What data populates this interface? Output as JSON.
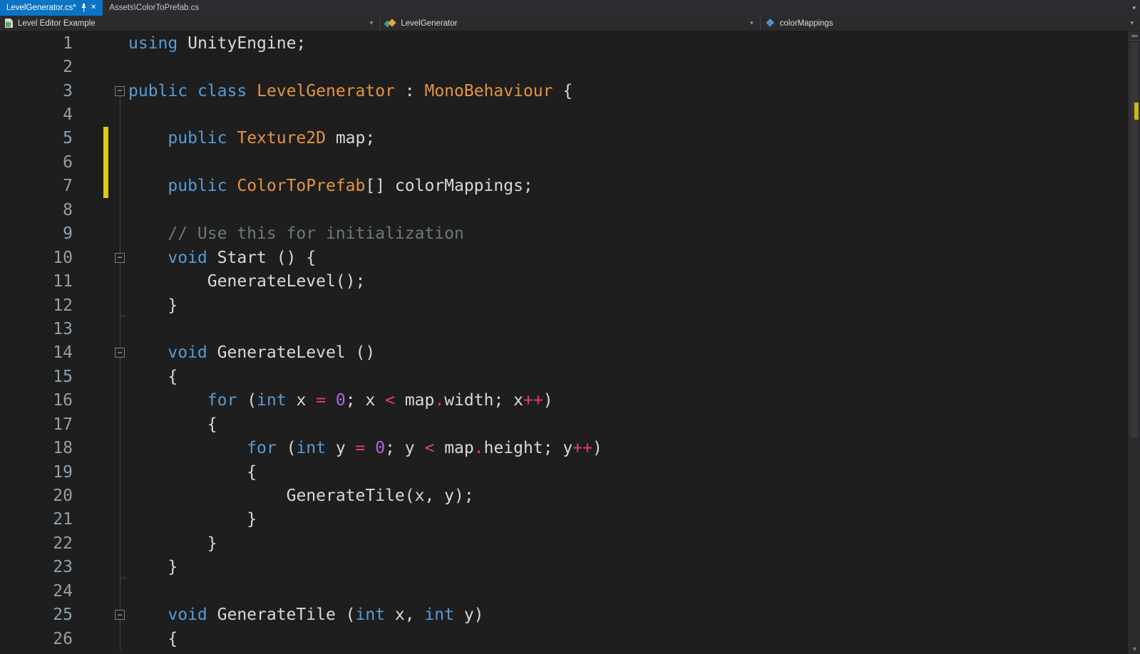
{
  "colors": {
    "accent_blue": "#0b74c4",
    "keyword": "#569cd6",
    "type": "#e39440",
    "operator": "#e23d7f",
    "number": "#a36ae0",
    "comment": "#6d787e",
    "plain": "#d8d8d8",
    "line_number": "#8fa0ac",
    "change_bar_yellow": "#ddc81c"
  },
  "icons": {
    "chevron_down": "▾",
    "close": "✕",
    "fold_collapse": "−"
  },
  "tabs": [
    {
      "label": "LevelGenerator.cs*",
      "active": true
    },
    {
      "label": "Assets\\ColorToPrefab.cs",
      "active": false
    }
  ],
  "nav": {
    "items": [
      {
        "label": "Level Editor Example"
      },
      {
        "label": "LevelGenerator"
      },
      {
        "label": "colorMappings"
      }
    ]
  },
  "editor": {
    "language": "csharp",
    "lines": [
      {
        "n": "1",
        "indent": 0,
        "tokens": [
          [
            "k",
            "using"
          ],
          [
            "p",
            " UnityEngine;"
          ]
        ]
      },
      {
        "n": "2",
        "indent": 0,
        "tokens": []
      },
      {
        "n": "3",
        "indent": 0,
        "fold": true,
        "tokens": [
          [
            "k",
            "public"
          ],
          [
            "p",
            " "
          ],
          [
            "k",
            "class"
          ],
          [
            "p",
            " "
          ],
          [
            "t",
            "LevelGenerator"
          ],
          [
            "p",
            " : "
          ],
          [
            "t",
            "MonoBehaviour"
          ],
          [
            "p",
            " {"
          ]
        ]
      },
      {
        "n": "4",
        "indent": 0,
        "guide": true,
        "tokens": []
      },
      {
        "n": "5",
        "indent": 1,
        "guide": true,
        "changed": true,
        "tokens": [
          [
            "k",
            "public"
          ],
          [
            "p",
            " "
          ],
          [
            "t",
            "Texture2D"
          ],
          [
            "p",
            " map;"
          ]
        ]
      },
      {
        "n": "6",
        "indent": 0,
        "guide": true,
        "changed": true,
        "tokens": []
      },
      {
        "n": "7",
        "indent": 1,
        "guide": true,
        "changed": true,
        "tokens": [
          [
            "k",
            "public"
          ],
          [
            "p",
            " "
          ],
          [
            "t",
            "ColorToPrefab"
          ],
          [
            "p",
            "[] colorMappings;"
          ]
        ]
      },
      {
        "n": "8",
        "indent": 0,
        "guide": true,
        "tokens": []
      },
      {
        "n": "9",
        "indent": 1,
        "guide": true,
        "tokens": [
          [
            "c",
            "// Use this for initialization"
          ]
        ]
      },
      {
        "n": "10",
        "indent": 1,
        "guide": true,
        "fold": true,
        "tokens": [
          [
            "k",
            "void"
          ],
          [
            "p",
            " Start () {"
          ]
        ]
      },
      {
        "n": "11",
        "indent": 2,
        "guide": true,
        "tokens": [
          [
            "p",
            "GenerateLevel();"
          ]
        ]
      },
      {
        "n": "12",
        "indent": 1,
        "guide": true,
        "tick": true,
        "tokens": [
          [
            "p",
            "}"
          ]
        ]
      },
      {
        "n": "13",
        "indent": 0,
        "guide": true,
        "tokens": []
      },
      {
        "n": "14",
        "indent": 1,
        "guide": true,
        "fold": true,
        "tokens": [
          [
            "k",
            "void"
          ],
          [
            "p",
            " GenerateLevel ()"
          ]
        ]
      },
      {
        "n": "15",
        "indent": 1,
        "guide": true,
        "tokens": [
          [
            "p",
            "{"
          ]
        ]
      },
      {
        "n": "16",
        "indent": 2,
        "guide": true,
        "tokens": [
          [
            "k",
            "for"
          ],
          [
            "p",
            " ("
          ],
          [
            "k",
            "int"
          ],
          [
            "p",
            " x "
          ],
          [
            "o",
            "="
          ],
          [
            "p",
            " "
          ],
          [
            "n",
            "0"
          ],
          [
            "p",
            "; x "
          ],
          [
            "o",
            "<"
          ],
          [
            "p",
            " map"
          ],
          [
            "o",
            "."
          ],
          [
            "p",
            "width; x"
          ],
          [
            "o",
            "++"
          ],
          [
            "p",
            ")"
          ]
        ]
      },
      {
        "n": "17",
        "indent": 2,
        "guide": true,
        "tokens": [
          [
            "p",
            "{"
          ]
        ]
      },
      {
        "n": "18",
        "indent": 3,
        "guide": true,
        "tokens": [
          [
            "k",
            "for"
          ],
          [
            "p",
            " ("
          ],
          [
            "k",
            "int"
          ],
          [
            "p",
            " y "
          ],
          [
            "o",
            "="
          ],
          [
            "p",
            " "
          ],
          [
            "n",
            "0"
          ],
          [
            "p",
            "; y "
          ],
          [
            "o",
            "<"
          ],
          [
            "p",
            " map"
          ],
          [
            "o",
            "."
          ],
          [
            "p",
            "height; y"
          ],
          [
            "o",
            "++"
          ],
          [
            "p",
            ")"
          ]
        ]
      },
      {
        "n": "19",
        "indent": 3,
        "guide": true,
        "tokens": [
          [
            "p",
            "{"
          ]
        ]
      },
      {
        "n": "20",
        "indent": 4,
        "guide": true,
        "tokens": [
          [
            "p",
            "GenerateTile(x, y);"
          ]
        ]
      },
      {
        "n": "21",
        "indent": 3,
        "guide": true,
        "tokens": [
          [
            "p",
            "}"
          ]
        ]
      },
      {
        "n": "22",
        "indent": 2,
        "guide": true,
        "tokens": [
          [
            "p",
            "}"
          ]
        ]
      },
      {
        "n": "23",
        "indent": 1,
        "guide": true,
        "tick": true,
        "tokens": [
          [
            "p",
            "}"
          ]
        ]
      },
      {
        "n": "24",
        "indent": 0,
        "guide": true,
        "tokens": []
      },
      {
        "n": "25",
        "indent": 1,
        "guide": true,
        "fold": true,
        "tokens": [
          [
            "k",
            "void"
          ],
          [
            "p",
            " GenerateTile ("
          ],
          [
            "k",
            "int"
          ],
          [
            "p",
            " x, "
          ],
          [
            "k",
            "int"
          ],
          [
            "p",
            " y)"
          ]
        ]
      },
      {
        "n": "26",
        "indent": 1,
        "guide": true,
        "tokens": [
          [
            "p",
            "{"
          ]
        ]
      }
    ]
  }
}
